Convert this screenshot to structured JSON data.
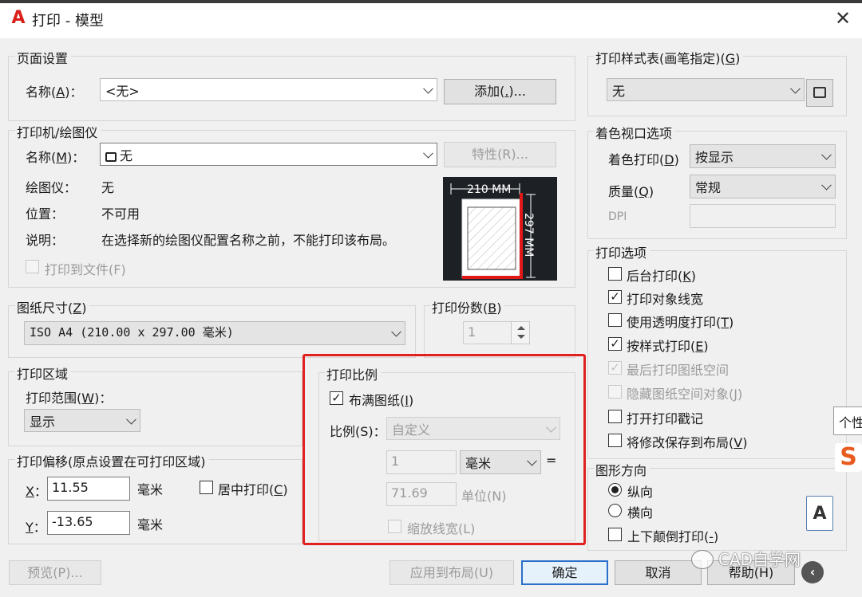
{
  "window": {
    "title": "打印 - 模型",
    "app_icon_letter": "A",
    "close_glyph": "✕"
  },
  "page_setup": {
    "group_title": "页面设置",
    "name_label_pre": "名称(",
    "name_label_key": "A",
    "name_label_post": ")：",
    "name_value": "<无>",
    "add_button_pre": "添加(",
    "add_button_key": ".",
    "add_button_post": ")..."
  },
  "printer": {
    "group_title": "打印机/绘图仪",
    "name_label_pre": "名称(",
    "name_label_key": "M",
    "name_label_post": ")：",
    "name_value": "无",
    "properties_button": "特性(R)...",
    "plotter_label": "绘图仪：",
    "plotter_value": "无",
    "location_label": "位置：",
    "location_value": "不可用",
    "description_label": "说明：",
    "description_value": "在选择新的绘图仪配置名称之前，不能打印该布局。",
    "print_to_file": "打印到文件(F)",
    "preview_width": "210 MM",
    "preview_height": "297 MM"
  },
  "paper_size": {
    "group_title_pre": "图纸尺寸(",
    "group_title_key": "Z",
    "group_title_post": ")",
    "value": "ISO A4 (210.00 x 297.00 毫米)"
  },
  "copies": {
    "group_title_pre": "打印份数(",
    "group_title_key": "B",
    "group_title_post": ")",
    "value": "1"
  },
  "plot_area": {
    "group_title": "打印区域",
    "range_label_pre": "打印范围(",
    "range_label_key": "W",
    "range_label_post": ")：",
    "range_value": "显示"
  },
  "plot_offset": {
    "group_title": "打印偏移(原点设置在可打印区域)",
    "x_label": "X",
    "x_value": "11.55",
    "x_unit": "毫米",
    "y_label": "Y",
    "y_value": "-13.65",
    "y_unit": "毫米",
    "center_label_pre": "居中打印(",
    "center_label_key": "C",
    "center_label_post": ")"
  },
  "plot_scale": {
    "group_title": "打印比例",
    "fit_paper_pre": "布满图纸(",
    "fit_paper_key": "I",
    "fit_paper_post": ")",
    "fit_paper_checked": true,
    "scale_label": "比例(S)：",
    "scale_value": "自定义",
    "value1": "1",
    "unit_value": "毫米",
    "equals": "=",
    "value2": "71.69",
    "unit_label": "单位(N)",
    "scale_lineweights": "缩放线宽(L)"
  },
  "plot_style_table": {
    "group_title_pre": "打印样式表(画笔指定)(",
    "group_title_key": "G",
    "group_title_post": ")",
    "value": "无"
  },
  "shaded_viewport": {
    "group_title": "着色视口选项",
    "shade_label_pre": "着色打印(",
    "shade_label_key": "D",
    "shade_label_post": ")",
    "shade_value": "按显示",
    "quality_label_pre": "质量(",
    "quality_label_key": "Q",
    "quality_label_post": ")",
    "quality_value": "常规",
    "dpi_label": "DPI",
    "dpi_value": ""
  },
  "plot_options": {
    "group_title": "打印选项",
    "items": [
      {
        "pre": "后台打印(",
        "key": "K",
        "post": ")",
        "checked": false,
        "disabled": false
      },
      {
        "pre": "打印对象线宽",
        "key": "",
        "post": "",
        "checked": true,
        "disabled": false
      },
      {
        "pre": "使用透明度打印(",
        "key": "T",
        "post": ")",
        "checked": false,
        "disabled": false
      },
      {
        "pre": "按样式打印(",
        "key": "E",
        "post": ")",
        "checked": true,
        "disabled": false
      },
      {
        "pre": "最后打印图纸空间",
        "key": "",
        "post": "",
        "checked": true,
        "disabled": true
      },
      {
        "pre": "隐藏图纸空间对象(",
        "key": "J",
        "post": ")",
        "checked": false,
        "disabled": true
      },
      {
        "pre": "打开打印戳记",
        "key": "",
        "post": "",
        "checked": false,
        "disabled": false
      },
      {
        "pre": "将修改保存到布局(",
        "key": "V",
        "post": ")",
        "checked": false,
        "disabled": false
      }
    ]
  },
  "orientation": {
    "group_title": "图形方向",
    "portrait": "纵向",
    "landscape": "横向",
    "upside_down_pre": "上下颠倒打印(",
    "upside_down_key": "-",
    "upside_down_post": ")",
    "selected": "portrait",
    "icon_letter": "A"
  },
  "footer": {
    "preview_button": "预览(P)...",
    "apply_button": "应用到布局(U)",
    "ok_button": "确定",
    "cancel_button": "取消",
    "help_button": "帮助(H)"
  },
  "overlay": {
    "tooltip": "个性",
    "s_logo": "S",
    "watermark": "CAD自学网"
  }
}
